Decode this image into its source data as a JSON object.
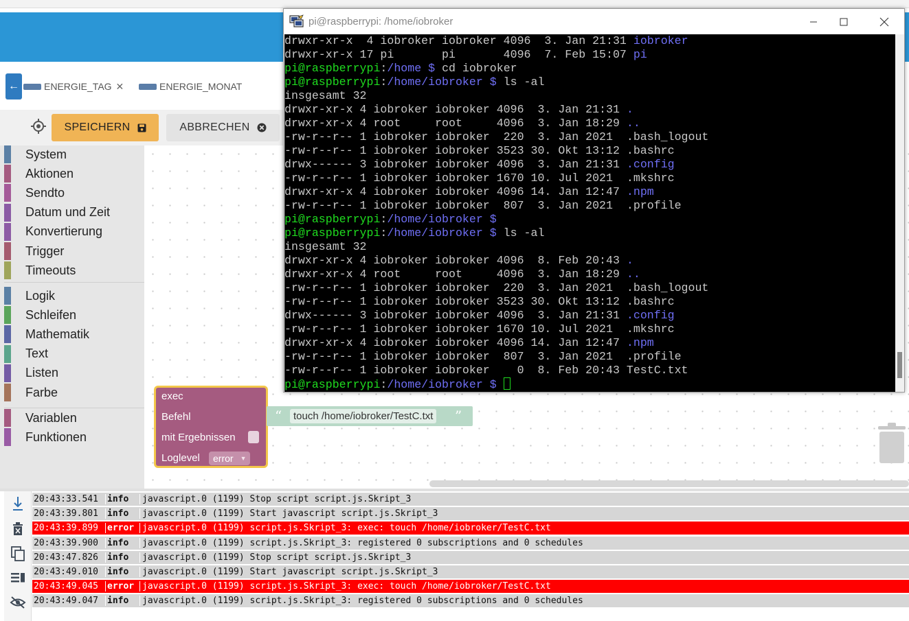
{
  "terminal": {
    "title": "pi@raspberrypi: /home/iobroker",
    "lines": [
      [
        {
          "t": "drwxr-xr-x  4 iobroker iobroker 4096  3. Jan 21:31 "
        },
        {
          "t": "iobroker",
          "c": "b"
        }
      ],
      [
        {
          "t": "drwxr-xr-x 17 pi       pi       4096  7. Feb 15:07 "
        },
        {
          "t": "pi",
          "c": "b"
        }
      ],
      [
        {
          "t": "pi@raspberrypi",
          "c": "g"
        },
        {
          "t": ":"
        },
        {
          "t": "/home $",
          "c": "b"
        },
        {
          "t": " cd iobroker"
        }
      ],
      [
        {
          "t": "pi@raspberrypi",
          "c": "g"
        },
        {
          "t": ":"
        },
        {
          "t": "/home/iobroker $",
          "c": "b"
        },
        {
          "t": " ls -al"
        }
      ],
      [
        {
          "t": "insgesamt 32"
        }
      ],
      [
        {
          "t": "drwxr-xr-x 4 iobroker iobroker 4096  3. Jan 21:31 "
        },
        {
          "t": ".",
          "c": "b"
        }
      ],
      [
        {
          "t": "drwxr-xr-x 4 root     root     4096  3. Jan 18:29 "
        },
        {
          "t": "..",
          "c": "b"
        }
      ],
      [
        {
          "t": "-rw-r--r-- 1 iobroker iobroker  220  3. Jan 2021  .bash_logout"
        }
      ],
      [
        {
          "t": "-rw-r--r-- 1 iobroker iobroker 3523 30. Okt 13:12 .bashrc"
        }
      ],
      [
        {
          "t": "drwx------ 3 iobroker iobroker 4096  3. Jan 21:31 "
        },
        {
          "t": ".config",
          "c": "b"
        }
      ],
      [
        {
          "t": "-rw-r--r-- 1 iobroker iobroker 1670 10. Jul 2021  .mkshrc"
        }
      ],
      [
        {
          "t": "drwxr-xr-x 4 iobroker iobroker 4096 14. Jan 12:47 "
        },
        {
          "t": ".npm",
          "c": "b"
        }
      ],
      [
        {
          "t": "-rw-r--r-- 1 iobroker iobroker  807  3. Jan 2021  .profile"
        }
      ],
      [
        {
          "t": "pi@raspberrypi",
          "c": "g"
        },
        {
          "t": ":"
        },
        {
          "t": "/home/iobroker $",
          "c": "b"
        }
      ],
      [
        {
          "t": "pi@raspberrypi",
          "c": "g"
        },
        {
          "t": ":"
        },
        {
          "t": "/home/iobroker $",
          "c": "b"
        },
        {
          "t": " ls -al"
        }
      ],
      [
        {
          "t": "insgesamt 32"
        }
      ],
      [
        {
          "t": "drwxr-xr-x 4 iobroker iobroker 4096  8. Feb 20:43 "
        },
        {
          "t": ".",
          "c": "b"
        }
      ],
      [
        {
          "t": "drwxr-xr-x 4 root     root     4096  3. Jan 18:29 "
        },
        {
          "t": "..",
          "c": "b"
        }
      ],
      [
        {
          "t": "-rw-r--r-- 1 iobroker iobroker  220  3. Jan 2021  .bash_logout"
        }
      ],
      [
        {
          "t": "-rw-r--r-- 1 iobroker iobroker 3523 30. Okt 13:12 .bashrc"
        }
      ],
      [
        {
          "t": "drwx------ 3 iobroker iobroker 4096  3. Jan 21:31 "
        },
        {
          "t": ".config",
          "c": "b"
        }
      ],
      [
        {
          "t": "-rw-r--r-- 1 iobroker iobroker 1670 10. Jul 2021  .mkshrc"
        }
      ],
      [
        {
          "t": "drwxr-xr-x 4 iobroker iobroker 4096 14. Jan 12:47 "
        },
        {
          "t": ".npm",
          "c": "b"
        }
      ],
      [
        {
          "t": "-rw-r--r-- 1 iobroker iobroker  807  3. Jan 2021  .profile"
        }
      ],
      [
        {
          "t": "-rw-r--r-- 1 iobroker iobroker    0  8. Feb 20:43 TestC.txt"
        }
      ],
      [
        {
          "t": "pi@raspberrypi",
          "c": "g"
        },
        {
          "t": ":"
        },
        {
          "t": "/home/iobroker $",
          "c": "b"
        },
        {
          "t": " "
        },
        {
          "cursor": true
        }
      ]
    ]
  },
  "tabs": {
    "tab1": "ENERGIE_TAG",
    "tab2": "ENERGIE_MONAT",
    "close": "✕"
  },
  "toolbar": {
    "save_label": "SPEICHERN",
    "cancel_label": "ABBRECHEN"
  },
  "categories": {
    "group1": [
      {
        "label": "System",
        "color": "#5b80a5"
      },
      {
        "label": "Aktionen",
        "color": "#a55b80"
      },
      {
        "label": "Sendto",
        "color": "#a55b99"
      },
      {
        "label": "Datum und Zeit",
        "color": "#8b5ba5"
      },
      {
        "label": "Konvertierung",
        "color": "#8d5ba5"
      },
      {
        "label": "Trigger",
        "color": "#a55b6e"
      },
      {
        "label": "Timeouts",
        "color": "#9fa55b"
      }
    ],
    "group2": [
      {
        "label": "Logik",
        "color": "#5b80a5"
      },
      {
        "label": "Schleifen",
        "color": "#5ba55b"
      },
      {
        "label": "Mathematik",
        "color": "#5b67a5"
      },
      {
        "label": "Text",
        "color": "#5ba58c"
      },
      {
        "label": "Listen",
        "color": "#745ba5"
      },
      {
        "label": "Farbe",
        "color": "#a5745b"
      }
    ],
    "group3": [
      {
        "label": "Variablen",
        "color": "#a55b80"
      },
      {
        "label": "Funktionen",
        "color": "#995ba5"
      }
    ]
  },
  "block": {
    "exec_label": "exec",
    "command_label": "Befehl",
    "results_label": "mit Ergebnissen",
    "loglevel_label": "Loglevel",
    "loglevel_value": "error",
    "command_value": "touch /home/iobroker/TestC.txt",
    "open_quote": "“",
    "close_quote": "”"
  },
  "log": [
    {
      "time": "20:43:33.541",
      "level": "info",
      "msg": "javascript.0 (1199) Stop script script.js.Skript_3"
    },
    {
      "time": "20:43:39.801",
      "level": "info",
      "msg": "javascript.0 (1199) Start javascript script.js.Skript_3"
    },
    {
      "time": "20:43:39.899",
      "level": "error",
      "msg": "javascript.0 (1199) script.js.Skript_3: exec: touch /home/iobroker/TestC.txt"
    },
    {
      "time": "20:43:39.900",
      "level": "info",
      "msg": "javascript.0 (1199) script.js.Skript_3: registered 0 subscriptions and 0 schedules"
    },
    {
      "time": "20:43:47.826",
      "level": "info",
      "msg": "javascript.0 (1199) Stop script script.js.Skript_3"
    },
    {
      "time": "20:43:49.010",
      "level": "info",
      "msg": "javascript.0 (1199) Start javascript script.js.Skript_3"
    },
    {
      "time": "20:43:49.045",
      "level": "error",
      "msg": "javascript.0 (1199) script.js.Skript_3: exec: touch /home/iobroker/TestC.txt"
    },
    {
      "time": "20:43:49.047",
      "level": "info",
      "msg": "javascript.0 (1199) script.js.Skript_3: registered 0 subscriptions and 0 schedules"
    }
  ],
  "colors": {
    "accent_blue": "#2b96d6",
    "save_button": "#f0b455",
    "error_row": "#ff0000",
    "exec_block": "#a55b80",
    "terminal_prompt": "#1fdc1f",
    "terminal_dir": "#6f6ff5"
  },
  "icons": {
    "back": "arrow-left-icon",
    "locate": "crosshair-icon",
    "save": "floppy-disk-icon",
    "cancel": "close-circle-icon",
    "log_tools": [
      "scroll-down-icon",
      "clear-log-icon",
      "copy-icon",
      "toggle-details-icon",
      "hide-icon"
    ],
    "terminal_app": "putty-icon",
    "window": [
      "minimize-icon",
      "maximize-icon",
      "close-icon"
    ]
  }
}
